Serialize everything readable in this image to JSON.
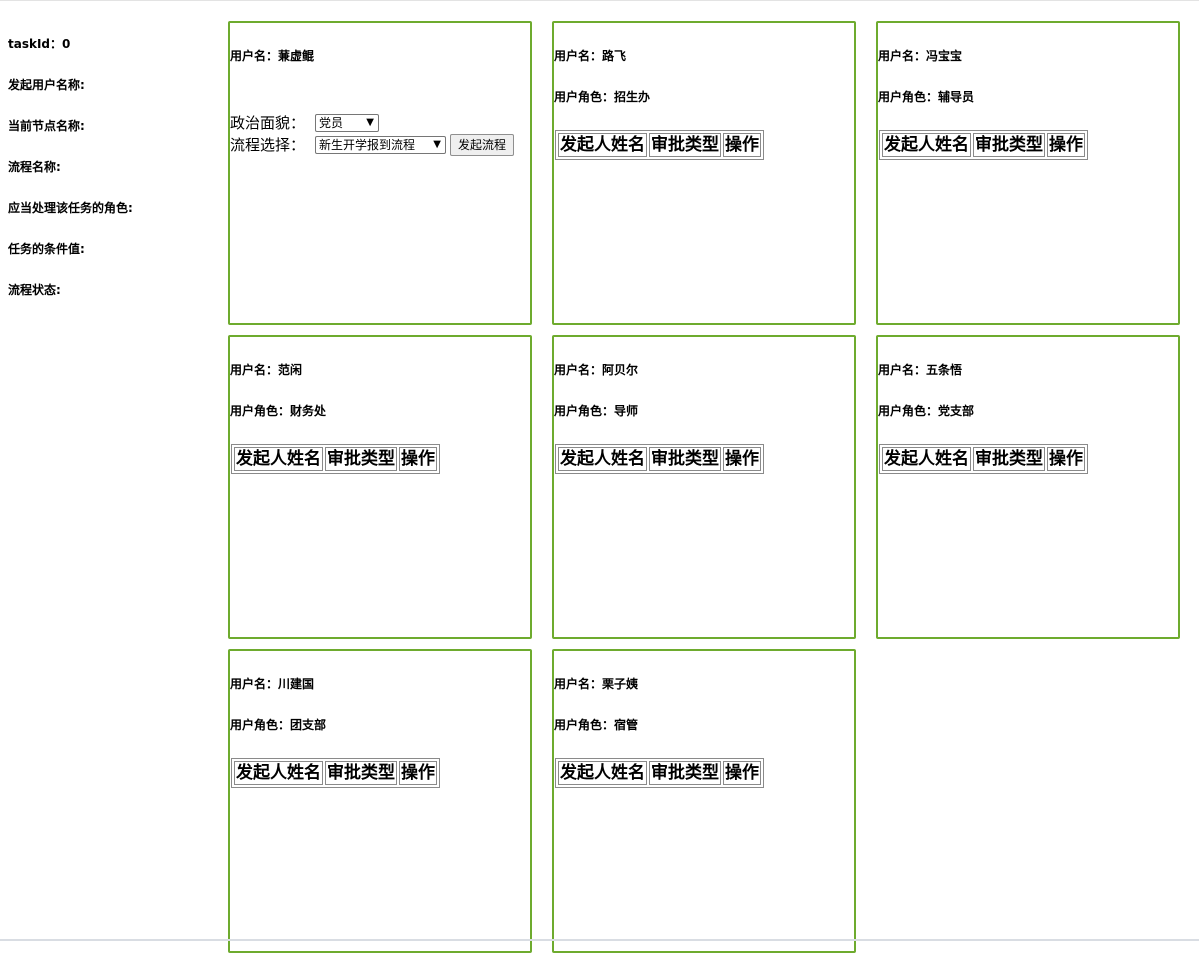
{
  "info": {
    "task_id": "taskId：0",
    "initiator": "发起用户名称:",
    "current_node": "当前节点名称:",
    "process_name": "流程名称:",
    "handler_role": "应当处理该任务的角色:",
    "condition": "任务的条件值:",
    "status": "流程状态:"
  },
  "starter": {
    "username": "用户名：蒹虚鲲",
    "political_label": "政治面貌：",
    "political_value": "党员",
    "process_label": "流程选择：",
    "process_value": "新生开学报到流程",
    "start_button": "发起流程"
  },
  "table_headers": [
    "发起人姓名",
    "审批类型",
    "操作"
  ],
  "cards": [
    {
      "username": "用户名：路飞",
      "role": "用户角色：招生办"
    },
    {
      "username": "用户名：冯宝宝",
      "role": "用户角色：辅导员"
    },
    {
      "username": "用户名：范闲",
      "role": "用户角色：财务处"
    },
    {
      "username": "用户名：阿贝尔",
      "role": "用户角色：导师"
    },
    {
      "username": "用户名：五条悟",
      "role": "用户角色：党支部"
    },
    {
      "username": "用户名：川建国",
      "role": "用户角色：团支部"
    },
    {
      "username": "用户名：栗子姨",
      "role": "用户角色：宿管"
    }
  ]
}
